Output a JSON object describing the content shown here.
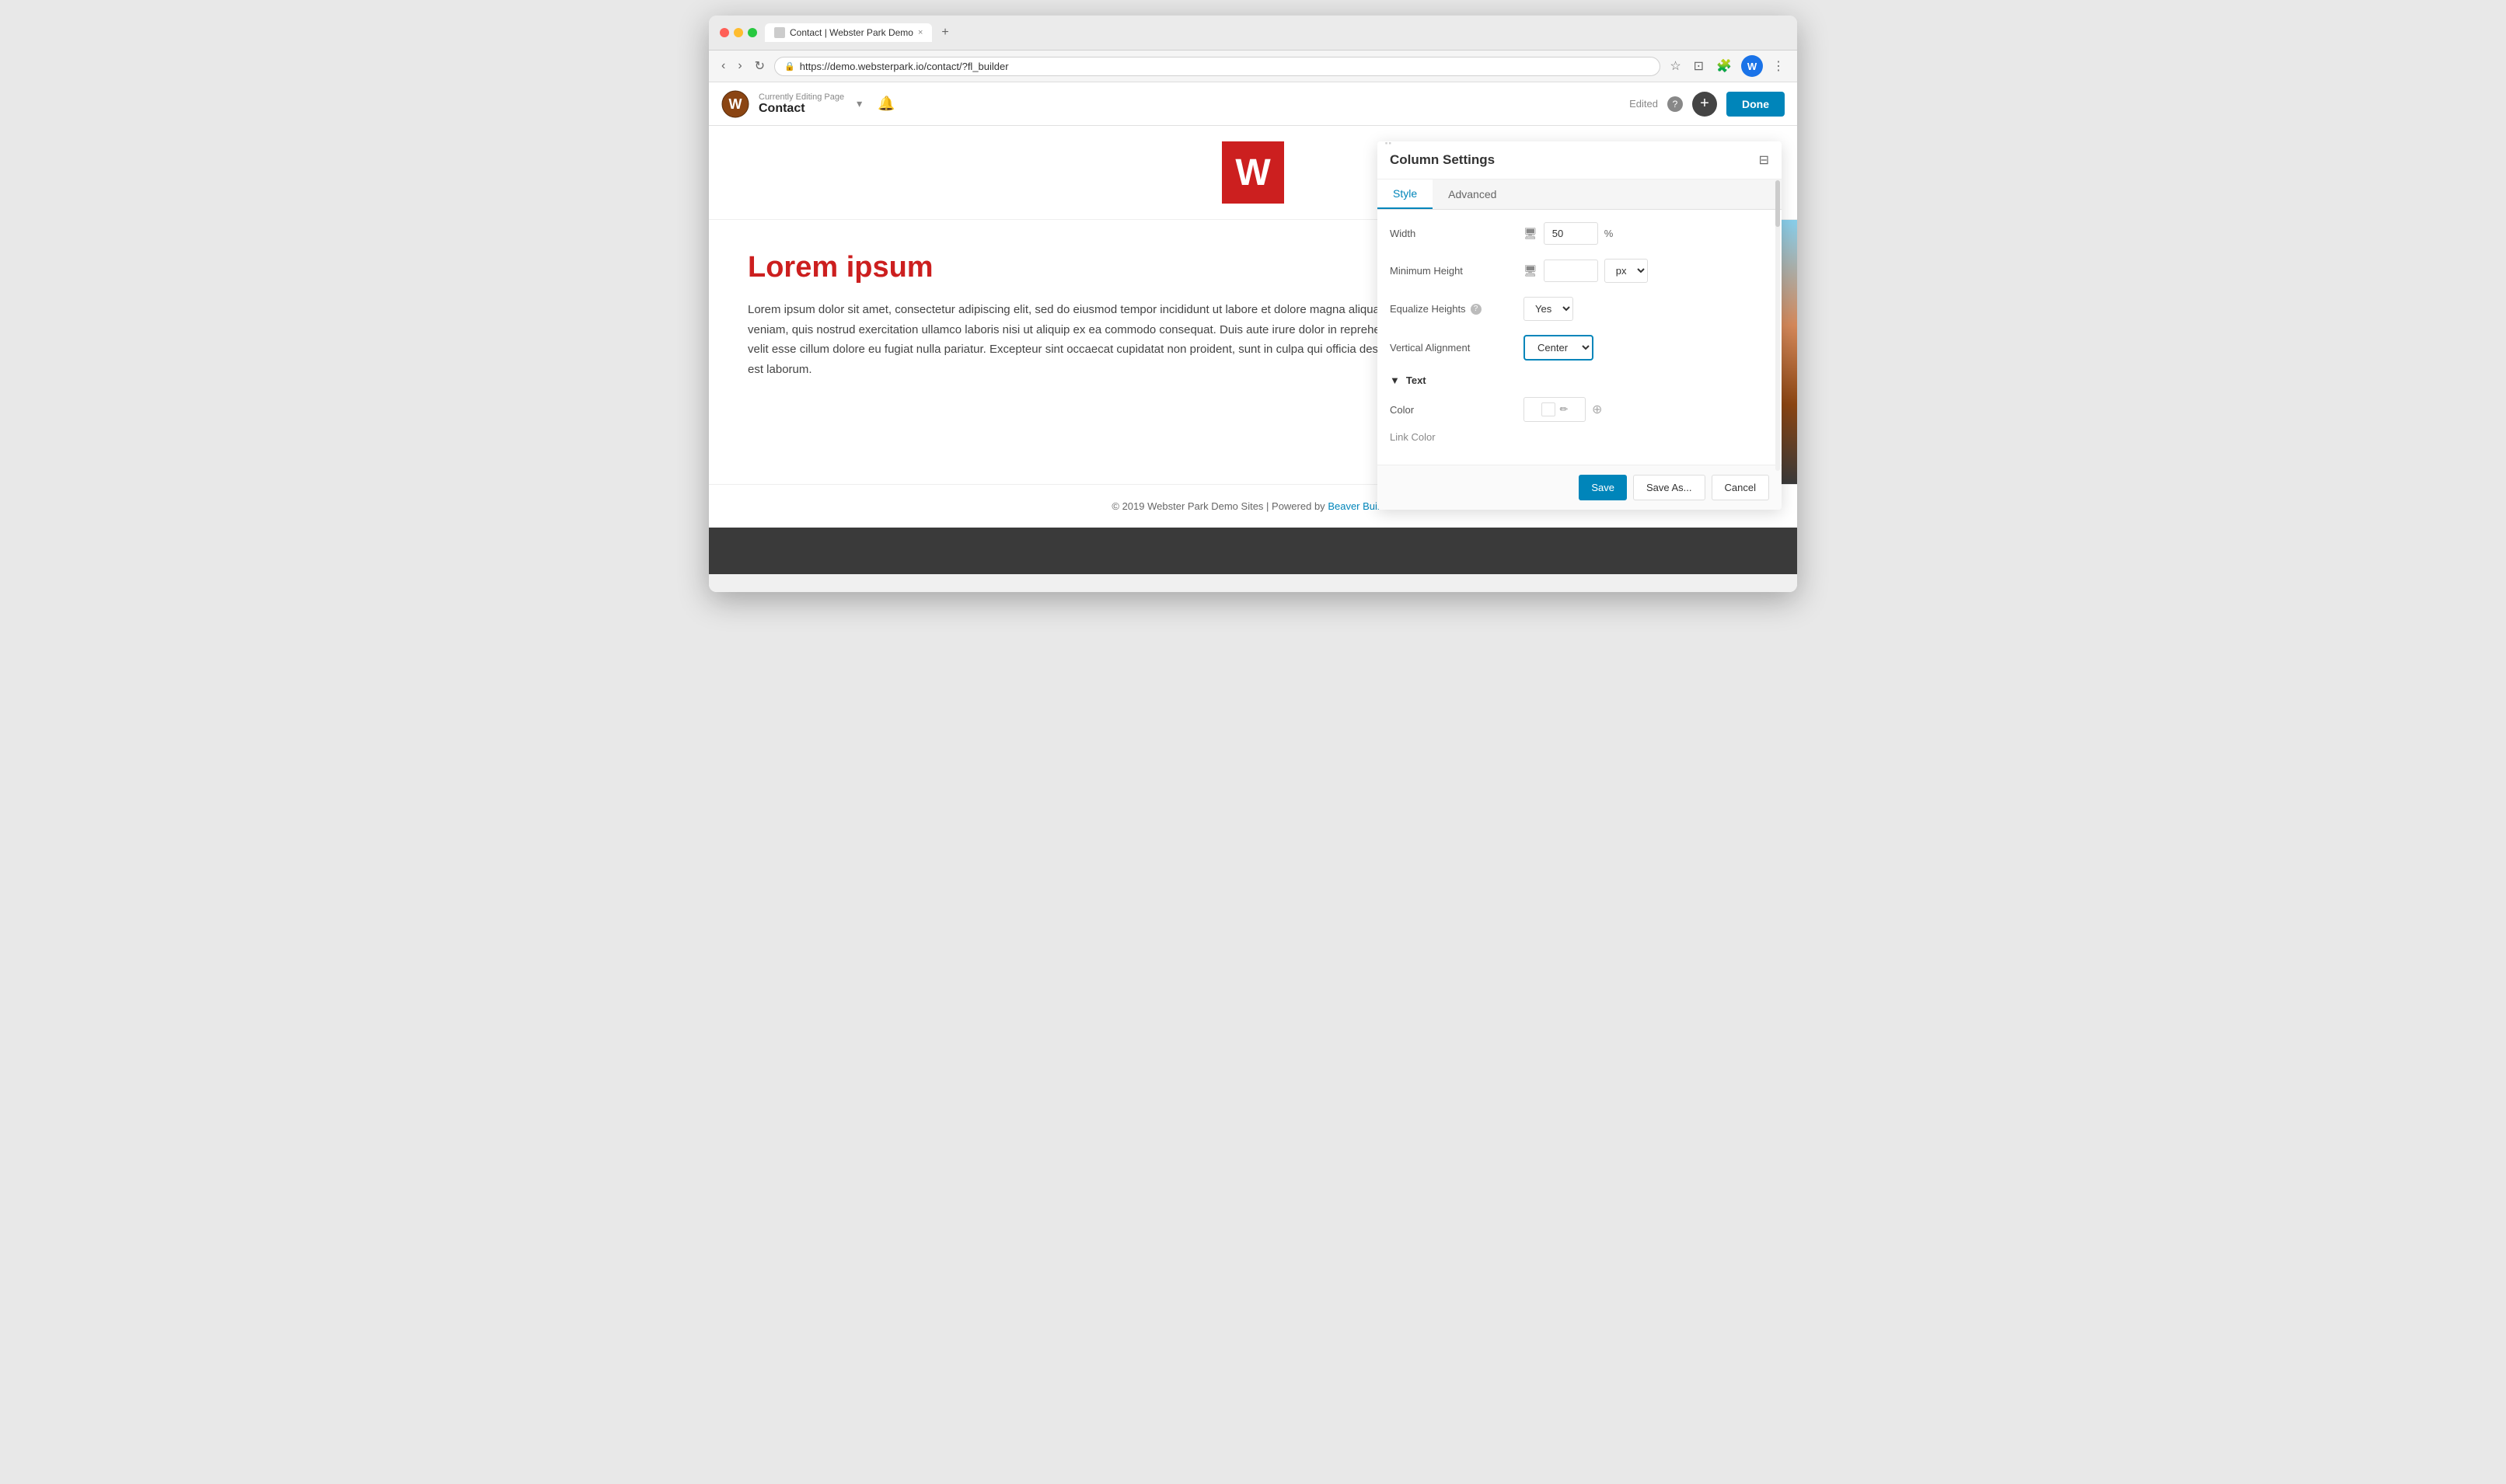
{
  "browser": {
    "tab_title": "Contact | Webster Park Demo",
    "tab_close": "×",
    "new_tab": "+",
    "nav_back": "‹",
    "nav_forward": "›",
    "nav_refresh": "↻",
    "address": "https://demo.websterpark.io/contact/?fl_builder",
    "toolbar_icons": [
      "★",
      "⊡",
      "🎥",
      "⋮"
    ],
    "user_initial": "W"
  },
  "admin_bar": {
    "currently_editing_label": "Currently Editing Page",
    "page_name": "Contact",
    "notification_icon": "🔔",
    "edited_text": "Edited",
    "help_text": "?",
    "plus_text": "+",
    "done_text": "Done"
  },
  "site": {
    "logo_letter": "W",
    "footer_text": "© 2019 Webster Park Demo Sites | Powered by",
    "footer_link_text": "Beaver Builder"
  },
  "content": {
    "heading": "Lorem ipsum",
    "body": "Lorem ipsum dolor sit amet, consectetur adipiscing elit, sed do eiusmod tempor incididunt ut labore et dolore magna aliqua. Ut enim ad minim veniam, quis nostrud exercitation ullamco laboris nisi ut aliquip ex ea commodo consequat. Duis aute irure dolor in reprehenderit in voluptate velit esse cillum dolore eu fugiat nulla pariatur. Excepteur sint occaecat cupidatat non proident, sunt in culpa qui officia deserunt mollit anim id est laborum."
  },
  "panel": {
    "title": "Column Settings",
    "collapse_icon": "⊟",
    "tabs": [
      "Style",
      "Advanced"
    ],
    "active_tab": "Style",
    "drag_icon": "⠿",
    "fields": {
      "width_label": "Width",
      "width_value": "50",
      "width_unit": "%",
      "desktop_icon": "🖥",
      "min_height_label": "Minimum Height",
      "min_height_value": "",
      "min_height_unit": "px",
      "equalize_label": "Equalize Heights",
      "equalize_help": "?",
      "equalize_value": "Yes",
      "vertical_align_label": "Vertical Alignment",
      "vertical_align_value": "Center"
    },
    "text_section": {
      "expand_icon": "▼",
      "label": "Text",
      "color_label": "Color",
      "link_color_label": "Link Color",
      "pencil_icon": "✏"
    },
    "footer": {
      "save_label": "Save",
      "save_as_label": "Save As...",
      "cancel_label": "Cancel"
    }
  }
}
